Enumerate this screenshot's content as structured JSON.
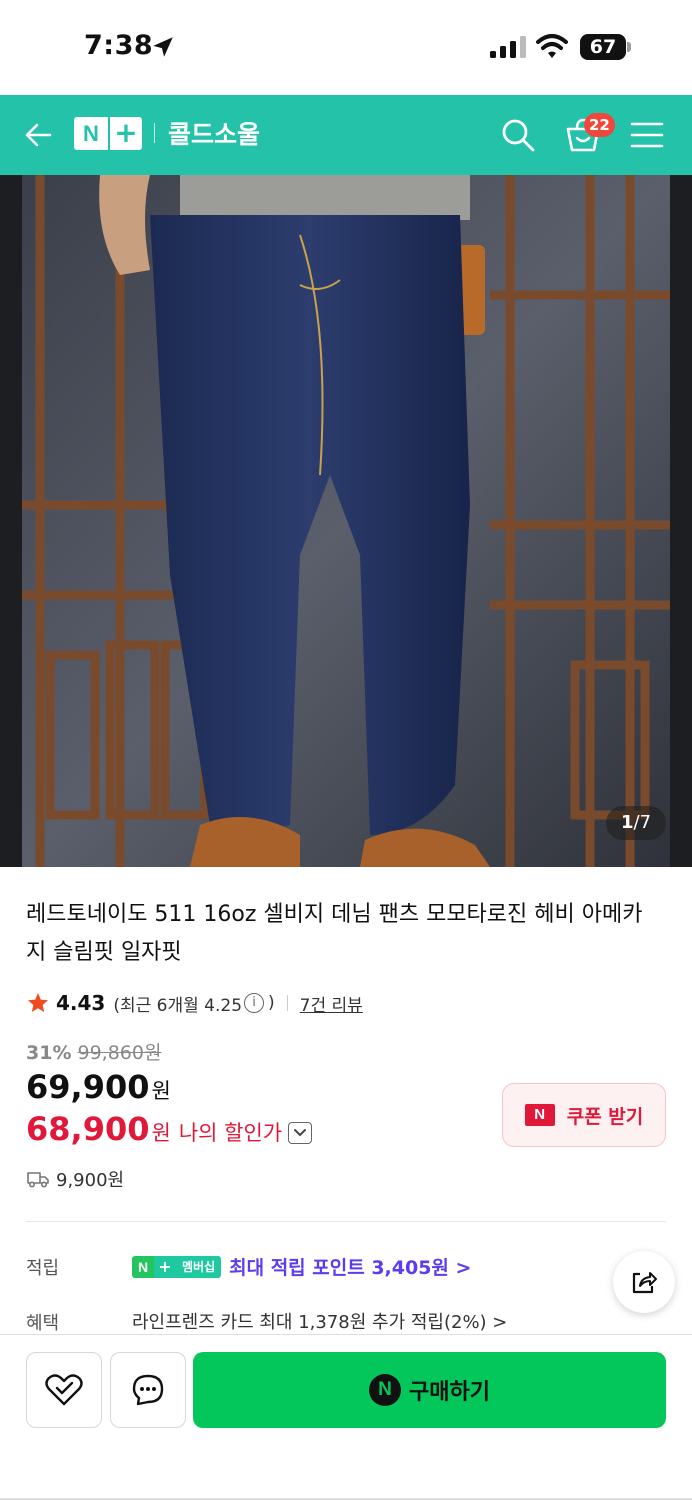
{
  "status_bar": {
    "time": "7:38",
    "battery": "67"
  },
  "header": {
    "brand_n": "N",
    "brand_plus": "+",
    "title": "콜드소울",
    "cart_count": "22",
    "icons": [
      "back-arrow-icon",
      "search-icon",
      "cart-icon",
      "menu-icon"
    ],
    "bg_color": "#24c2a8"
  },
  "gallery": {
    "current": "1",
    "total": "/7"
  },
  "product": {
    "title": "레드토네이도 511 16oz 셀비지 데님 팬츠 모모타로진 헤비 아메카지 슬림핏 일자핏",
    "rating": "4.43",
    "rating_detail": "(최근 6개월 4.25",
    "rating_info": "i",
    "rating_close": ")",
    "review_link": "7건 리뷰",
    "discount_pct": "31%",
    "original_price": "99,860원",
    "price": "69,900",
    "price_unit": "원",
    "my_price": "68,900",
    "my_price_unit": "원",
    "my_price_label": "나의 할인가",
    "coupon_badge": "N",
    "coupon_label": "쿠폰 받기",
    "shipping": "9,900원"
  },
  "benefits": {
    "points_label": "적립",
    "membership_n": "N",
    "membership_plus": "+",
    "membership_tag": "멤버십",
    "points_text": "최대 적립 포인트 3,405원 >",
    "benefit_label": "혜택",
    "benefit_text": "라인프렌즈 카드 최대 1,378원 추가 적립(2%) >"
  },
  "bottom_bar": {
    "buy_badge": "N",
    "buy_label": "구매하기",
    "buy_color": "#03c75a"
  },
  "colors": {
    "accent_red": "#e0193a",
    "membership_purple": "#5b3cf0"
  }
}
